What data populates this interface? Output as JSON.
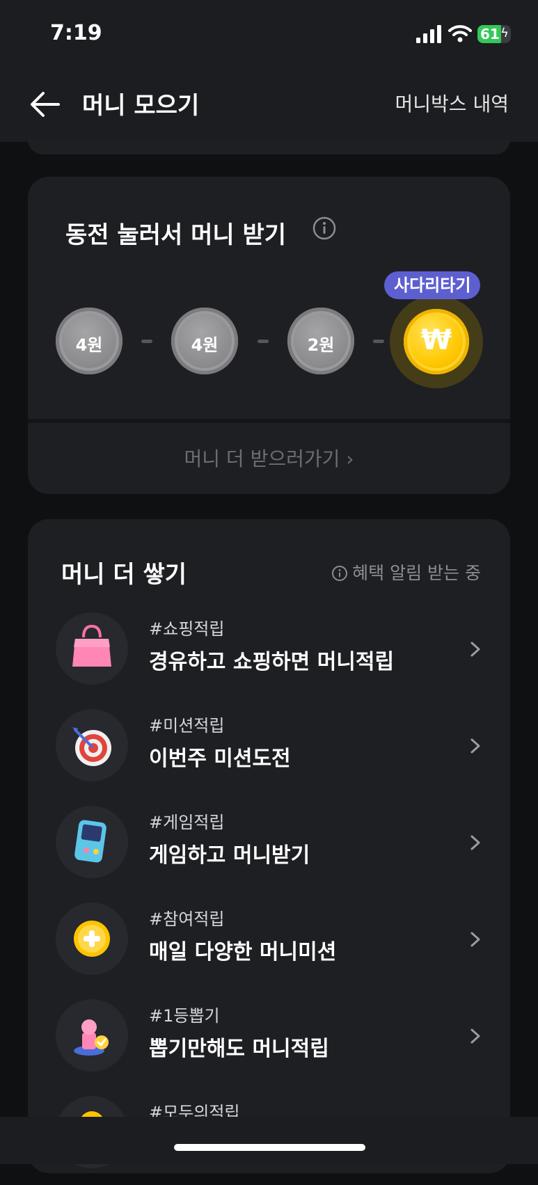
{
  "status": {
    "time": "7:19",
    "battery": "61"
  },
  "nav": {
    "title": "머니 모으기",
    "right": "머니박스 내역"
  },
  "coins_card": {
    "title": "동전 눌러서 머니 받기",
    "coins": [
      "4원",
      "4원",
      "2원"
    ],
    "gold_symbol": "₩",
    "badge": "사다리타기",
    "link": "머니 더 받으러가기 ›"
  },
  "more_card": {
    "title": "머니 더 쌓기",
    "right_label": "혜택 알림 받는 중",
    "items": [
      {
        "tag": "#쇼핑적립",
        "label": "경유하고 쇼핑하면 머니적립",
        "icon": "shopping-bag-icon"
      },
      {
        "tag": "#미션적립",
        "label": "이번주 미션도전",
        "icon": "target-dart-icon"
      },
      {
        "tag": "#게임적립",
        "label": "게임하고 머니받기",
        "icon": "game-console-icon"
      },
      {
        "tag": "#참여적립",
        "label": "매일 다양한 머니미션",
        "icon": "plus-coin-icon"
      },
      {
        "tag": "#1등뽑기",
        "label": "뽑기만해도 머니적립",
        "icon": "stamp-icon"
      },
      {
        "tag": "#모두의적립",
        "label": "",
        "icon": "coin-icon"
      }
    ]
  }
}
